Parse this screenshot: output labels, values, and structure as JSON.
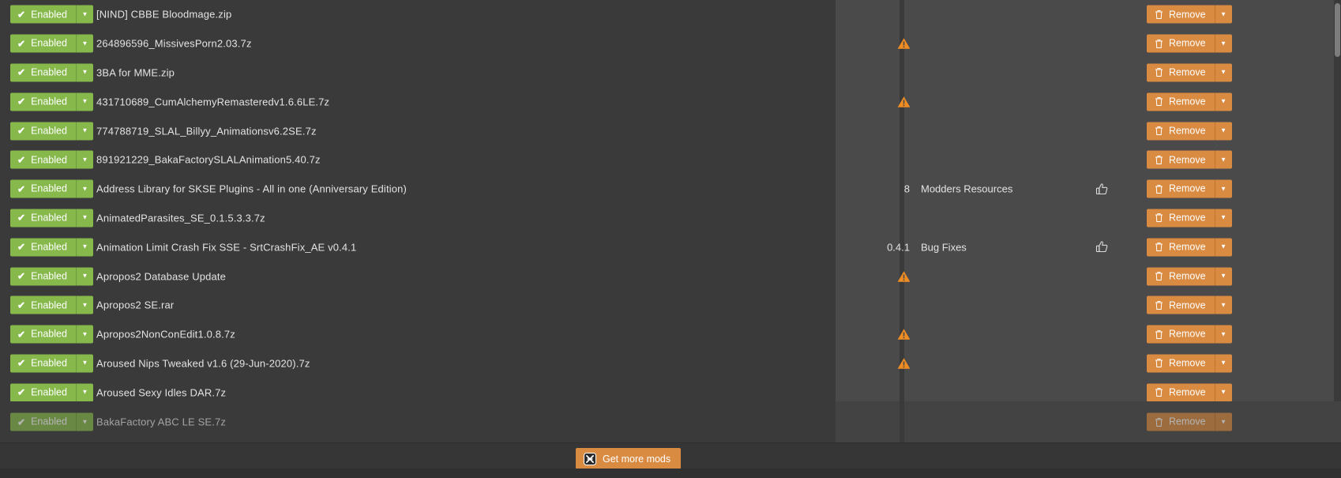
{
  "app": {
    "theme_bg": "#3a3a3a",
    "panel_bg": "#4a4a4a",
    "enabled_color": "#86b84b",
    "remove_color": "#d98b42",
    "warning_color": "#ef8c22"
  },
  "labels": {
    "enabled": "Enabled",
    "remove": "Remove",
    "caret": "▼",
    "check": "✔",
    "get_more_mods": "Get more mods"
  },
  "mods": [
    {
      "name": "[NIND] CBBE Bloodmage.zip",
      "enabled": "Enabled",
      "version": "",
      "category": "",
      "warning": false,
      "endorsed": false,
      "remove": "Remove"
    },
    {
      "name": "264896596_MissivesPorn2.03.7z",
      "enabled": "Enabled",
      "version": "",
      "category": "",
      "warning": true,
      "endorsed": false,
      "remove": "Remove"
    },
    {
      "name": "3BA for MME.zip",
      "enabled": "Enabled",
      "version": "",
      "category": "",
      "warning": false,
      "endorsed": false,
      "remove": "Remove"
    },
    {
      "name": "431710689_CumAlchemyRemasteredv1.6.6LE.7z",
      "enabled": "Enabled",
      "version": "",
      "category": "",
      "warning": true,
      "endorsed": false,
      "remove": "Remove"
    },
    {
      "name": "774788719_SLAL_Billyy_Animationsv6.2SE.7z",
      "enabled": "Enabled",
      "version": "",
      "category": "",
      "warning": false,
      "endorsed": false,
      "remove": "Remove"
    },
    {
      "name": "891921229_BakaFactorySLALAnimation5.40.7z",
      "enabled": "Enabled",
      "version": "",
      "category": "",
      "warning": false,
      "endorsed": false,
      "remove": "Remove"
    },
    {
      "name": "Address Library for SKSE Plugins - All in one (Anniversary Edition)",
      "enabled": "Enabled",
      "version": "8",
      "category": "Modders Resources",
      "warning": false,
      "endorsed": true,
      "remove": "Remove"
    },
    {
      "name": "AnimatedParasites_SE_0.1.5.3.3.7z",
      "enabled": "Enabled",
      "version": "",
      "category": "",
      "warning": false,
      "endorsed": false,
      "remove": "Remove"
    },
    {
      "name": "Animation Limit Crash Fix SSE - SrtCrashFix_AE v0.4.1",
      "enabled": "Enabled",
      "version": "0.4.1",
      "category": "Bug Fixes",
      "warning": false,
      "endorsed": true,
      "remove": "Remove"
    },
    {
      "name": "Apropos2 Database Update",
      "enabled": "Enabled",
      "version": "",
      "category": "",
      "warning": true,
      "endorsed": false,
      "remove": "Remove"
    },
    {
      "name": "Apropos2 SE.rar",
      "enabled": "Enabled",
      "version": "",
      "category": "",
      "warning": false,
      "endorsed": false,
      "remove": "Remove"
    },
    {
      "name": "Apropos2NonConEdit1.0.8.7z",
      "enabled": "Enabled",
      "version": "",
      "category": "",
      "warning": true,
      "endorsed": false,
      "remove": "Remove"
    },
    {
      "name": "Aroused Nips Tweaked v1.6 (29-Jun-2020).7z",
      "enabled": "Enabled",
      "version": "",
      "category": "",
      "warning": true,
      "endorsed": false,
      "remove": "Remove"
    },
    {
      "name": "Aroused Sexy Idles DAR.7z",
      "enabled": "Enabled",
      "version": "",
      "category": "",
      "warning": false,
      "endorsed": false,
      "remove": "Remove"
    }
  ],
  "partial_row": {
    "name": "BakaFactory ABC LE SE.7z",
    "enabled": "Enabled",
    "remove": "Remove"
  }
}
